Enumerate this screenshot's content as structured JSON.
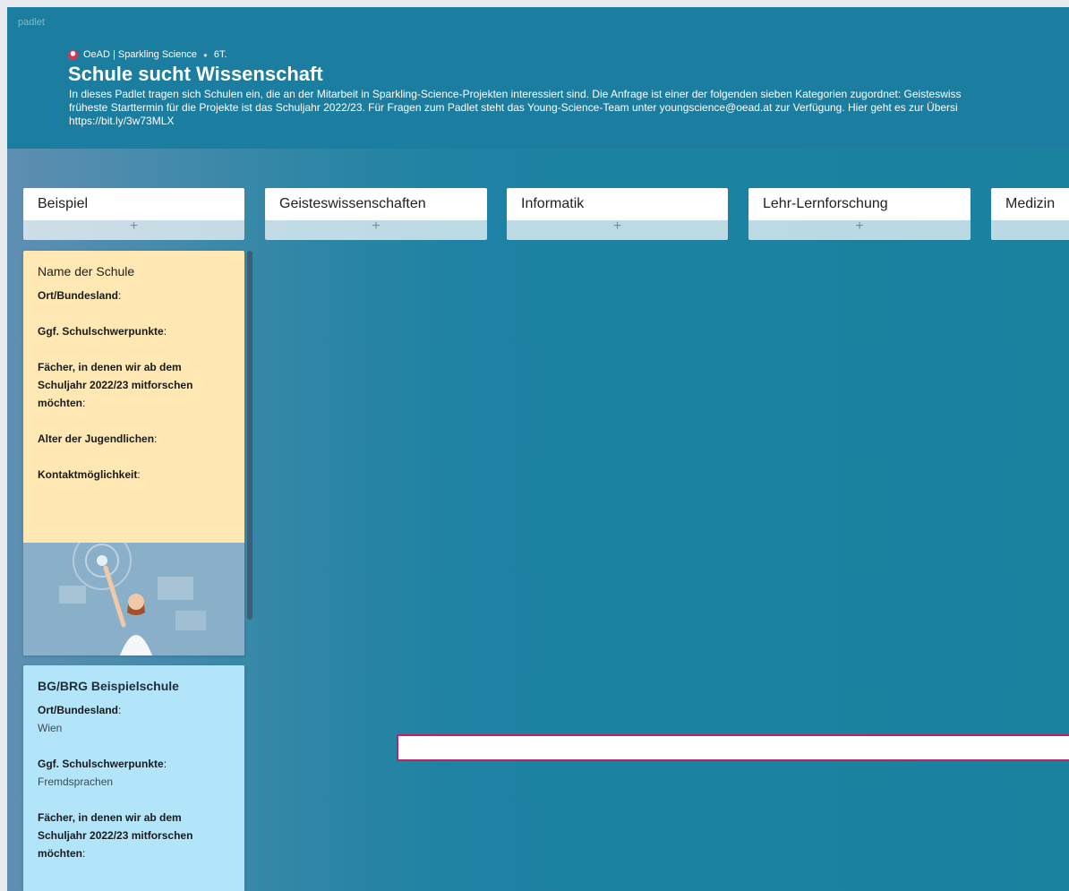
{
  "app": {
    "brand": "padlet"
  },
  "header": {
    "author": "OeAD | Sparkling Science",
    "age": "6T.",
    "title": "Schule sucht Wissenschaft",
    "description_lines": [
      "In dieses Padlet tragen sich Schulen ein, die an der Mitarbeit in Sparkling-Science-Projekten interessiert sind. Die Anfrage ist einer der folgenden sieben Kategorien zugordnet: Geisteswiss",
      "früheste Starttermin für die Projekte ist das Schuljahr 2022/23. Für Fragen zum Padlet steht das Young-Science-Team unter youngscience@oead.at zur Verfügung. Hier geht es zur Übersi",
      "https://bit.ly/3w73MLX"
    ]
  },
  "columns": [
    {
      "title": "Beispiel",
      "add_label": "+"
    },
    {
      "title": "Geisteswissenschaften",
      "add_label": "+"
    },
    {
      "title": "Informatik",
      "add_label": "+"
    },
    {
      "title": "Lehr-Lernforschung",
      "add_label": "+"
    },
    {
      "title": "Medizin",
      "add_label": "+"
    }
  ],
  "posts": [
    {
      "title": "Name der Schule",
      "fields": [
        {
          "label": "Ort/Bundesland",
          "value": ""
        },
        {
          "label": "Ggf. Schulschwerpunkte",
          "value": ""
        },
        {
          "label_lines": [
            "Fächer, in denen wir ab dem",
            "Schuljahr 2022/23 mitforschen",
            "möchten"
          ],
          "value": ""
        },
        {
          "label": "Alter der Jugendlichen",
          "value": ""
        },
        {
          "label": "Kontaktmöglichkeit",
          "value": ""
        }
      ],
      "color": "#ffe8b3"
    },
    {
      "title": "BG/BRG Beispielschule",
      "fields": [
        {
          "label": "Ort/Bundesland",
          "value": "Wien"
        },
        {
          "label": "Ggf. Schulschwerpunkte",
          "value": "Fremdsprachen"
        },
        {
          "label_lines": [
            "Fächer, in denen wir ab dem",
            "Schuljahr 2022/23 mitforschen",
            "möchten"
          ],
          "value": ""
        }
      ],
      "color": "#b3e5fa"
    }
  ],
  "colors": {
    "header_bg": "#1b7da0",
    "search_border": "#c4205f"
  }
}
